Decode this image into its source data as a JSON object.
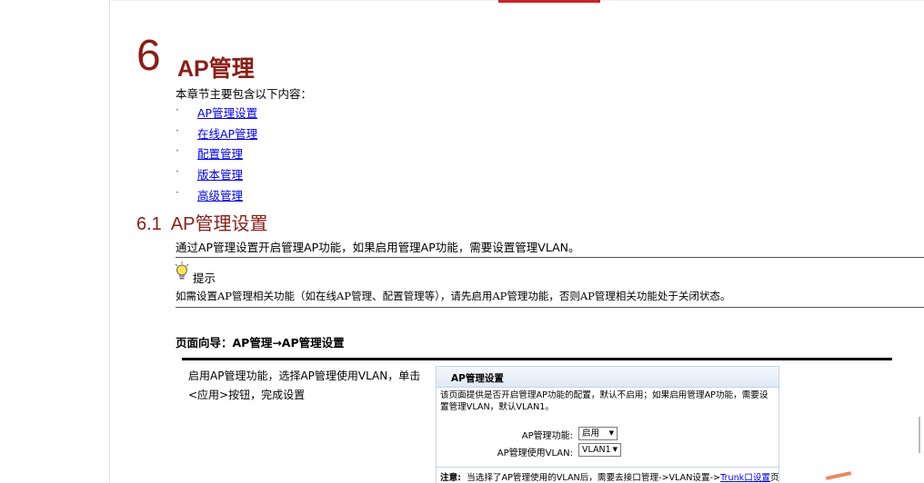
{
  "chapter": {
    "number": "6",
    "title": "AP管理"
  },
  "intro": "本章节主要包含以下内容：",
  "toc": {
    "bullet": "·",
    "items": [
      {
        "label": "AP管理设置"
      },
      {
        "label": "在线AP管理"
      },
      {
        "label": "配置管理"
      },
      {
        "label": "版本管理"
      },
      {
        "label": "高级管理"
      }
    ]
  },
  "section": {
    "number": "6.1",
    "title": "AP管理设置",
    "description": "通过AP管理设置开启管理AP功能，如果启用管理AP功能，需要设置管理VLAN。"
  },
  "tip": {
    "label": "提示",
    "text": "如需设置AP管理相关功能（如在线AP管理、配置管理等），请先启用AP管理功能，否则AP管理相关功能处于关闭状态。"
  },
  "navigation": "页面向导：AP管理→AP管理设置",
  "step": {
    "text": "启用AP管理功能，选择AP管理使用VLAN，单击<应用>按钮，完成设置"
  },
  "panel": {
    "title": "AP管理设置",
    "description": "该页面提供是否开启管理AP功能的配置，默认不启用；如果启用管理AP功能，需要设置管理VLAN，默认VLAN1。",
    "fields": [
      {
        "label": "AP管理功能:",
        "value": "启用"
      },
      {
        "label": "AP管理使用VLAN:",
        "value": "VLAN1"
      }
    ],
    "note_label": "注意:",
    "note_text": "当选择了AP管理使用的VLAN后，需要去接口管理->VLAN设置->",
    "note_link": "Trunk口设置",
    "note_suffix": "页面"
  },
  "colors": {
    "heading": "#8b1d16",
    "link": "#0000ee",
    "accent": "#c8242c"
  }
}
